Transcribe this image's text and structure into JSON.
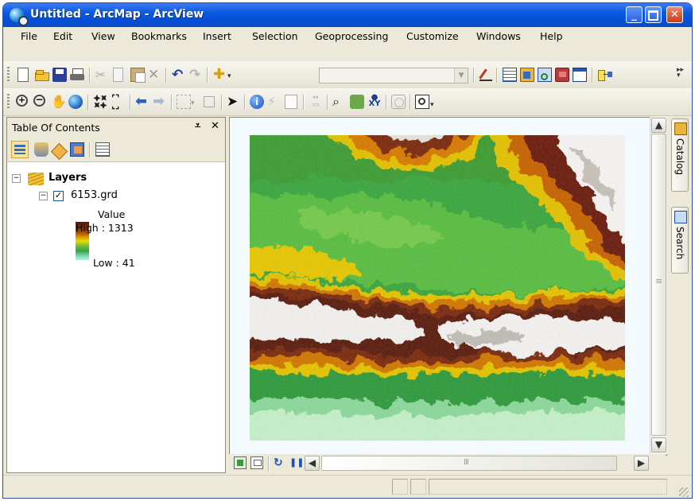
{
  "window": {
    "title": "Untitled - ArcMap - ArcView"
  },
  "menu": [
    "File",
    "Edit",
    "View",
    "Bookmarks",
    "Insert",
    "Selection",
    "Geoprocessing",
    "Customize",
    "Windows",
    "Help"
  ],
  "toc": {
    "title": "Table Of Contents",
    "pin_glyph": "⩡",
    "close_glyph": "✕",
    "root_label": "Layers",
    "layer_name": "6153.grd",
    "legend_field": "Value",
    "legend_high": "High : 1313",
    "legend_low": "Low : 41"
  },
  "side_tabs": [
    "Catalog",
    "Search"
  ],
  "scroll": {
    "h_grip": "III",
    "v_grip": "≡"
  },
  "colors": {
    "title_blue": "#0a5ae0",
    "accent": "#3d7af0",
    "dem_low": "#a6ecc8",
    "dem_mid": "#4db33f",
    "dem_yellow": "#e2c400",
    "dem_orange": "#c05a00",
    "dem_brown": "#6e1e0c",
    "dem_high": "#ffffff"
  }
}
